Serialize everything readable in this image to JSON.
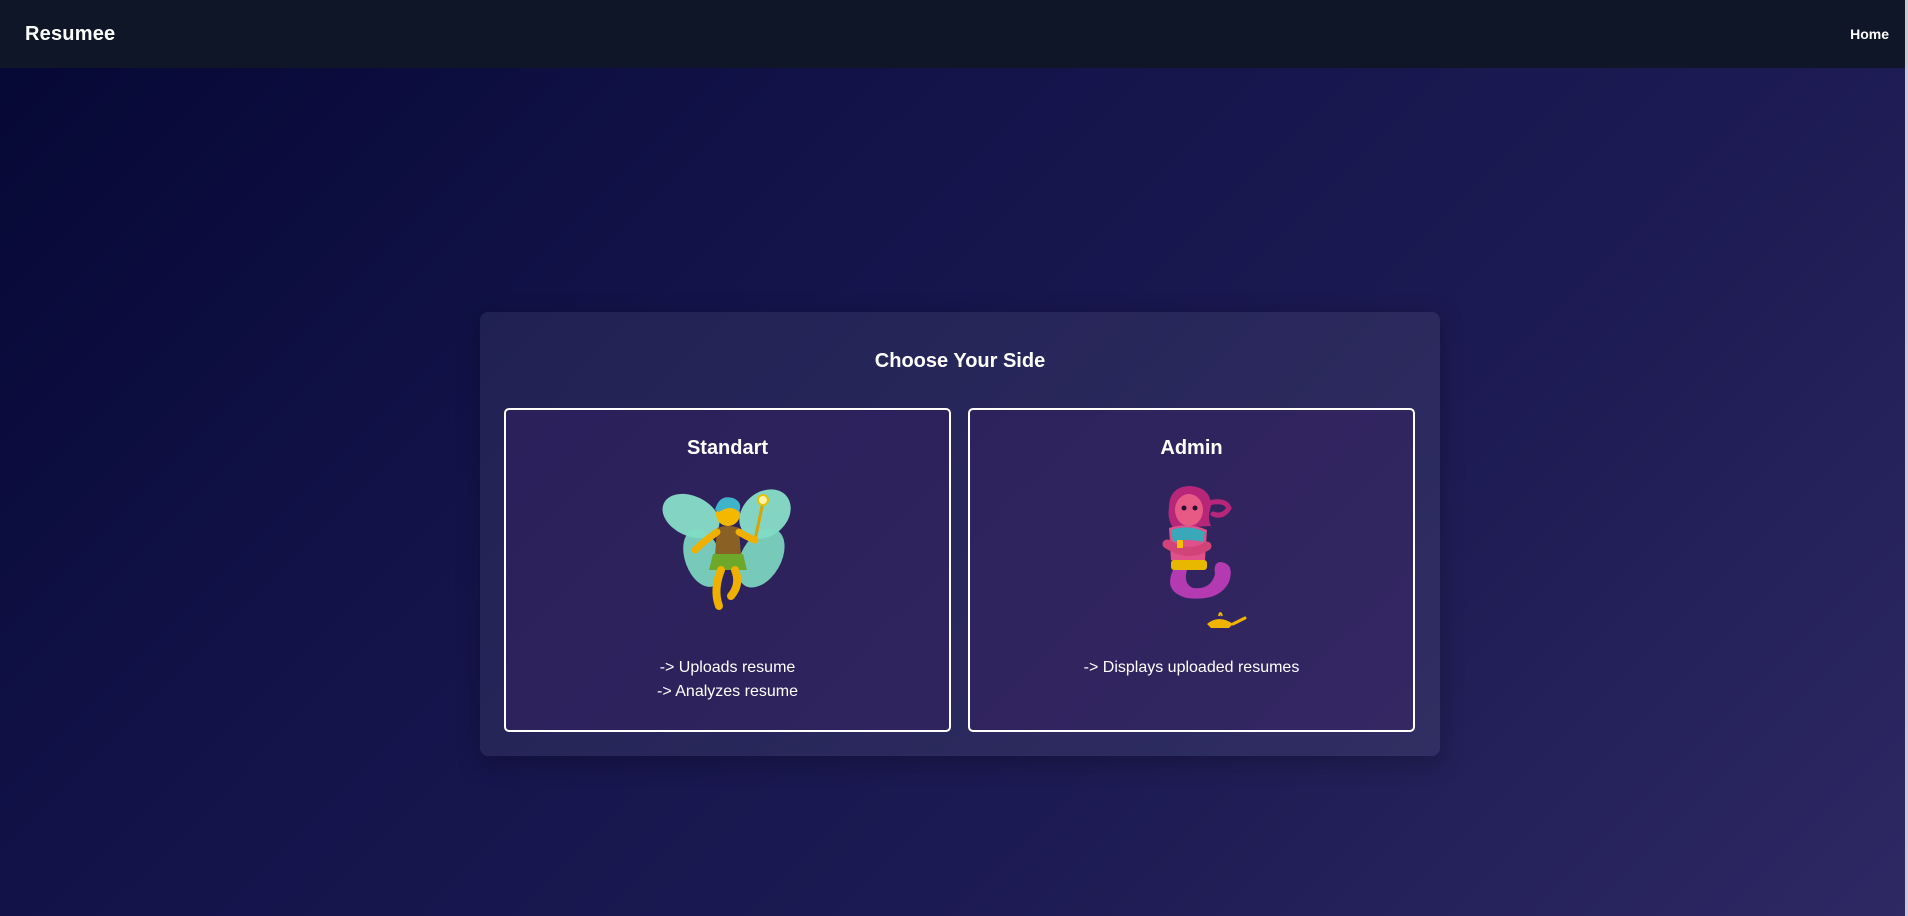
{
  "navbar": {
    "brand": "Resumee",
    "home_link": "Home"
  },
  "panel": {
    "title": "Choose Your Side"
  },
  "cards": [
    {
      "title": "Standart",
      "illustration": "fairy-icon",
      "lines": [
        "-> Uploads resume",
        "-> Analyzes resume"
      ]
    },
    {
      "title": "Admin",
      "illustration": "genie-icon",
      "lines": [
        "-> Displays uploaded resumes"
      ]
    }
  ],
  "colors": {
    "navbar_bg": "#0f1628",
    "page_gradient_start": "#050733",
    "page_gradient_end": "#2e2863",
    "card_border": "#ffffff"
  }
}
